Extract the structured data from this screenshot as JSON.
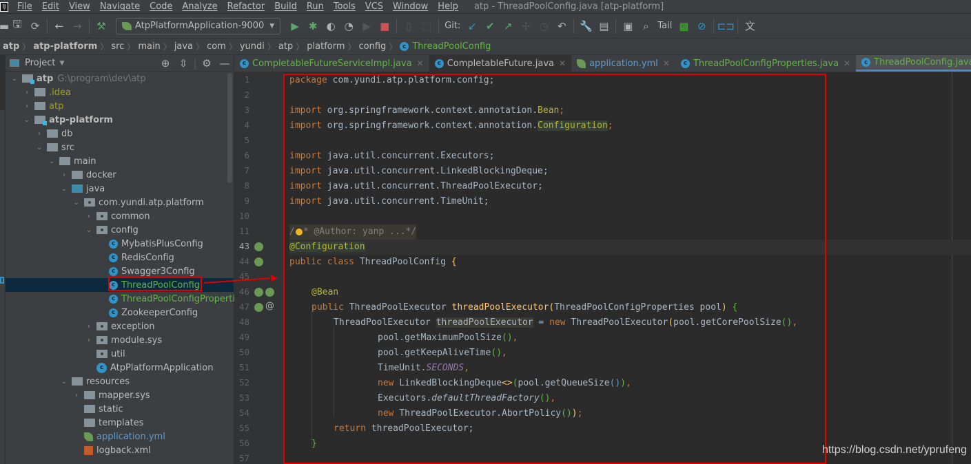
{
  "window": {
    "title": "atp - ThreadPoolConfig.java [atp-platform]",
    "menu": [
      "File",
      "Edit",
      "View",
      "Navigate",
      "Code",
      "Analyze",
      "Refactor",
      "Build",
      "Run",
      "Tools",
      "VCS",
      "Window",
      "Help"
    ]
  },
  "toolbar": {
    "run_config": "AtpPlatformApplication-9000",
    "git_label": "Git:",
    "tail_label": "Tail"
  },
  "breadcrumb": [
    "atp",
    "atp-platform",
    "src",
    "main",
    "java",
    "com",
    "yundi",
    "atp",
    "platform",
    "config",
    "ThreadPoolConfig"
  ],
  "project_panel": {
    "title": "Project",
    "root_path": "G:\\program\\dev\\atp",
    "tree": [
      {
        "label": "atp",
        "style": "bold"
      },
      {
        "label": ".idea",
        "style": "olive"
      },
      {
        "label": "atp",
        "style": "olive"
      },
      {
        "label": "atp-platform",
        "style": "bold"
      },
      {
        "label": "db"
      },
      {
        "label": "src"
      },
      {
        "label": "main"
      },
      {
        "label": "docker"
      },
      {
        "label": "java"
      },
      {
        "label": "com.yundi.atp.platform"
      },
      {
        "label": "common"
      },
      {
        "label": "config"
      },
      {
        "label": "MybatisPlusConfig"
      },
      {
        "label": "RedisConfig"
      },
      {
        "label": "Swagger3Config"
      },
      {
        "label": "ThreadPoolConfig",
        "style": "green",
        "selected": true
      },
      {
        "label": "ThreadPoolConfigProperties",
        "style": "green"
      },
      {
        "label": "ZookeeperConfig"
      },
      {
        "label": "exception"
      },
      {
        "label": "module.sys"
      },
      {
        "label": "util"
      },
      {
        "label": "AtpPlatformApplication"
      },
      {
        "label": "resources"
      },
      {
        "label": "mapper.sys"
      },
      {
        "label": "static"
      },
      {
        "label": "templates"
      },
      {
        "label": "application.yml",
        "style": "blue"
      },
      {
        "label": "logback.xml"
      }
    ]
  },
  "tabs": [
    {
      "label": "CompletableFutureServiceImpl.java"
    },
    {
      "label": "CompletableFuture.java"
    },
    {
      "label": "application.yml"
    },
    {
      "label": "ThreadPoolConfigProperties.java"
    },
    {
      "label": "ThreadPoolConfig.java",
      "active": true
    }
  ],
  "editor": {
    "line_numbers": [
      "1",
      "2",
      "3",
      "4",
      "5",
      "6",
      "7",
      "8",
      "9",
      "10",
      "11",
      "43",
      "44",
      "45",
      "46",
      "47",
      "48",
      "49",
      "50",
      "51",
      "52",
      "53",
      "54",
      "55",
      "56",
      "57"
    ],
    "lines": {
      "l1_kw": "package",
      "l1_rest": " com.yundi.atp.platform.config;",
      "import": "import",
      "l3_rest": " org.springframework.context.annotation.",
      "l3_cls": "Bean",
      "l4_cls": "Configuration",
      "l6_rest": " java.util.concurrent.Executors;",
      "l7_rest": " java.util.concurrent.LinkedBlockingDeque;",
      "l8_rest": " java.util.concurrent.ThreadPoolExecutor;",
      "l9_rest": " java.util.concurrent.TimeUnit;",
      "l11_a": "/",
      "l11_b": "* @Author: yanp ...*/",
      "l43": "@Configuration",
      "public": "public",
      "class": " class ",
      "l44_name": "ThreadPoolConfig ",
      "l46": "@Bean",
      "l47_type": " ThreadPoolExecutor ",
      "l47_fn": "threadPoolExecutor",
      "l47_params": "ThreadPoolConfigProperties pool",
      "l48_type": "ThreadPoolExecutor ",
      "l48_var": "threadPoolExecutor",
      "l48_eq": " = ",
      "new": "new",
      "l48_ctor": " ThreadPoolExecutor",
      "l48_arg": "pool.getCorePoolSize",
      "l49": "pool.getMaximumPoolSize",
      "l50": "pool.getKeepAliveTime",
      "l51_a": "TimeUnit.",
      "l51_b": "SECONDS",
      "l52_a": " LinkedBlockingDeque",
      "l52_b": "pool.getQueueSize",
      "l53_a": "Executors.",
      "l53_b": "defaultThreadFactory",
      "l54_a": " ThreadPoolExecutor.AbortPolicy",
      "return": "return",
      "l55_rest": " threadPoolExecutor;"
    }
  },
  "watermark": "https://blog.csdn.net/yprufeng",
  "colors": {
    "accent": "#4a88c7",
    "highlight_box": "#e00000",
    "keyword": "#cc7832",
    "annotation": "#bbb529"
  }
}
